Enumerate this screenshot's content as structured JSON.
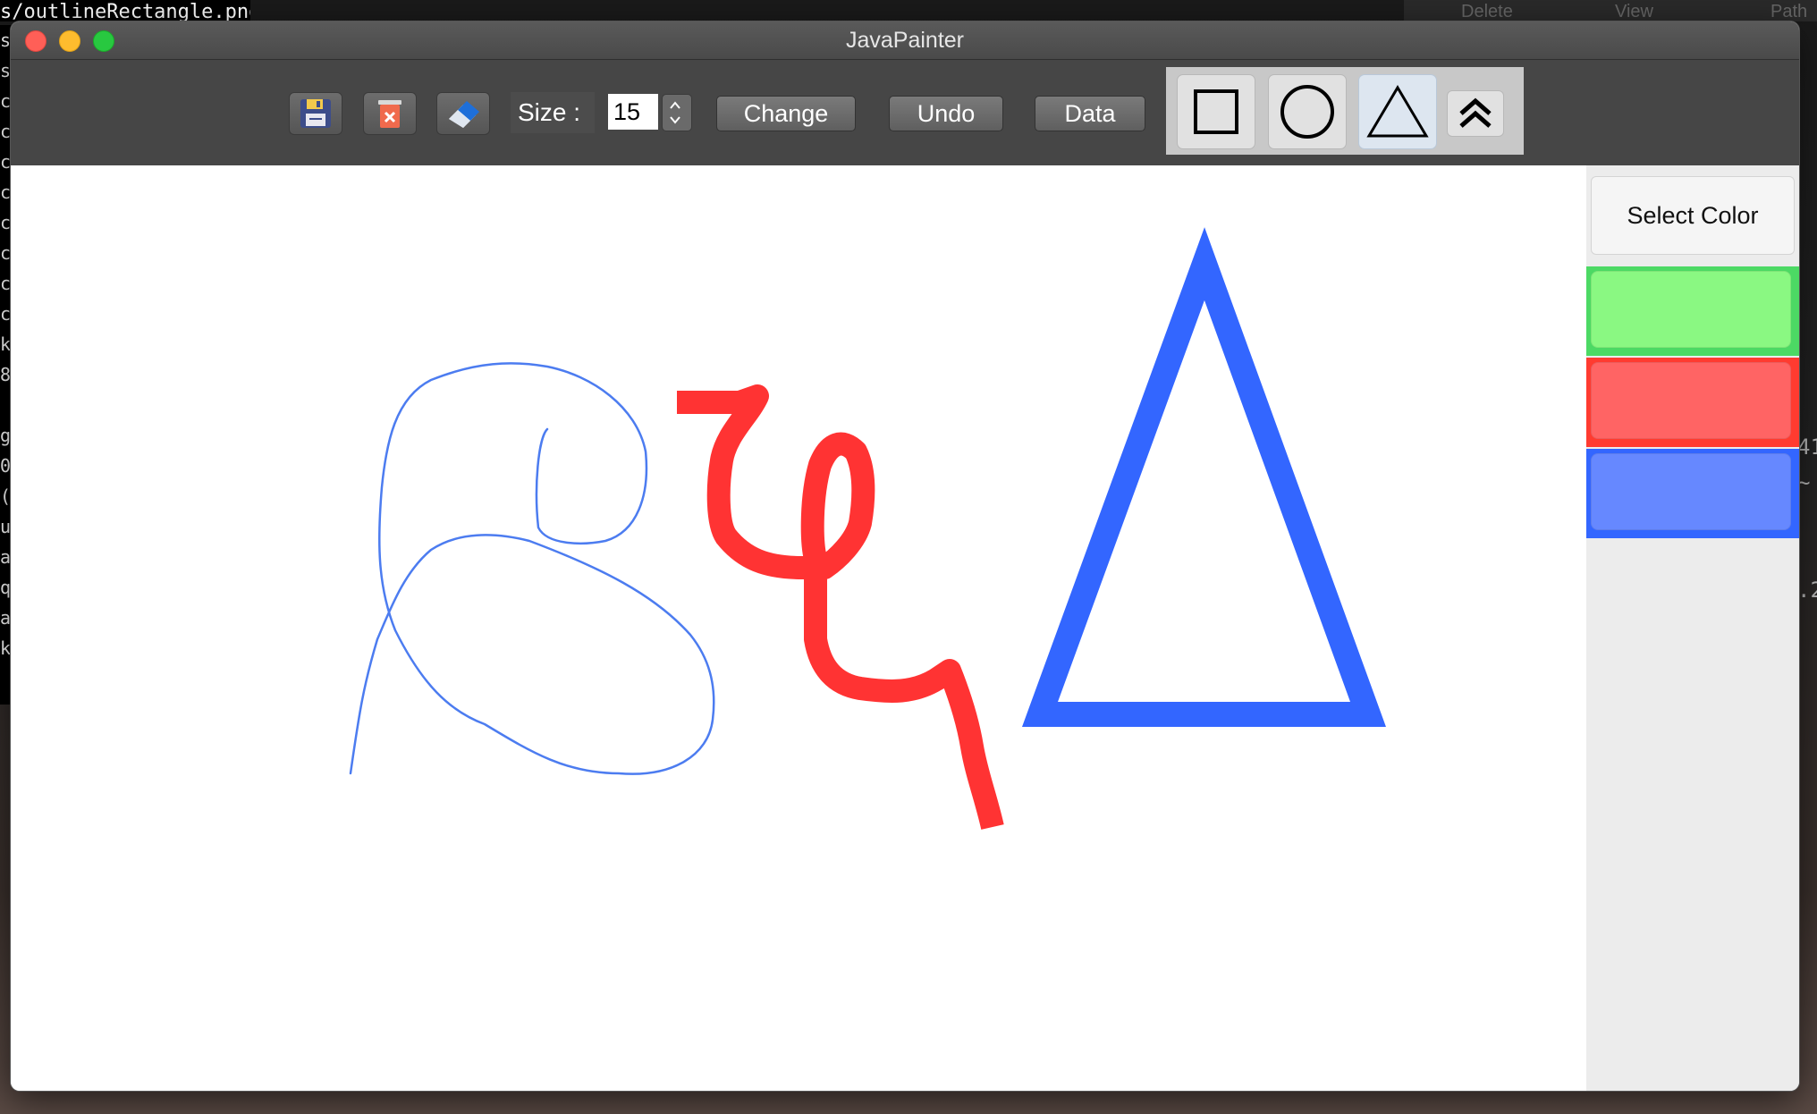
{
  "background": {
    "terminal_title": "s/outlineRectangle.png",
    "terminal_lines": [
      "s",
      "s",
      "c",
      "c",
      "c",
      "c",
      "c",
      "c",
      "c",
      "c",
      "k",
      "8",
      "",
      "g",
      "0",
      "(",
      "u",
      "a",
      "q",
      "a",
      "k"
    ],
    "back_menu": [
      "Delete",
      "View",
      "Path"
    ],
    "side_text": [
      "41",
      "~",
      "",
      "",
      ".2"
    ]
  },
  "window": {
    "title": "JavaPainter"
  },
  "toolbar": {
    "save_icon": "floppy-disk-icon",
    "delete_icon": "trash-can-icon",
    "eraser_icon": "eraser-icon",
    "size_label": "Size :",
    "size_value": "15",
    "change_label": "Change",
    "undo_label": "Undo",
    "data_label": "Data",
    "shapes": [
      {
        "name": "rectangle",
        "icon": "square-icon"
      },
      {
        "name": "circle",
        "icon": "circle-icon"
      },
      {
        "name": "triangle",
        "icon": "triangle-icon",
        "selected": true
      }
    ],
    "collapse_icon": "double-chevron-up-icon"
  },
  "sidebar": {
    "select_color_label": "Select Color",
    "swatches": [
      {
        "name": "green",
        "outer": "#4cd964",
        "inner": "#8af882"
      },
      {
        "name": "red",
        "outer": "#ff3b30",
        "inner": "#ff6464"
      },
      {
        "name": "blue",
        "outer": "#3366ff",
        "inner": "#6688ff"
      }
    ],
    "selected_swatch": "blue"
  },
  "canvas": {
    "strokes": [
      {
        "color": "#4c7cf0",
        "kind": "freehand",
        "width": "thin"
      },
      {
        "color": "#ff3333",
        "kind": "freehand",
        "width": 15
      },
      {
        "color": "#3366ff",
        "kind": "triangle-outline",
        "width": 15
      }
    ]
  }
}
